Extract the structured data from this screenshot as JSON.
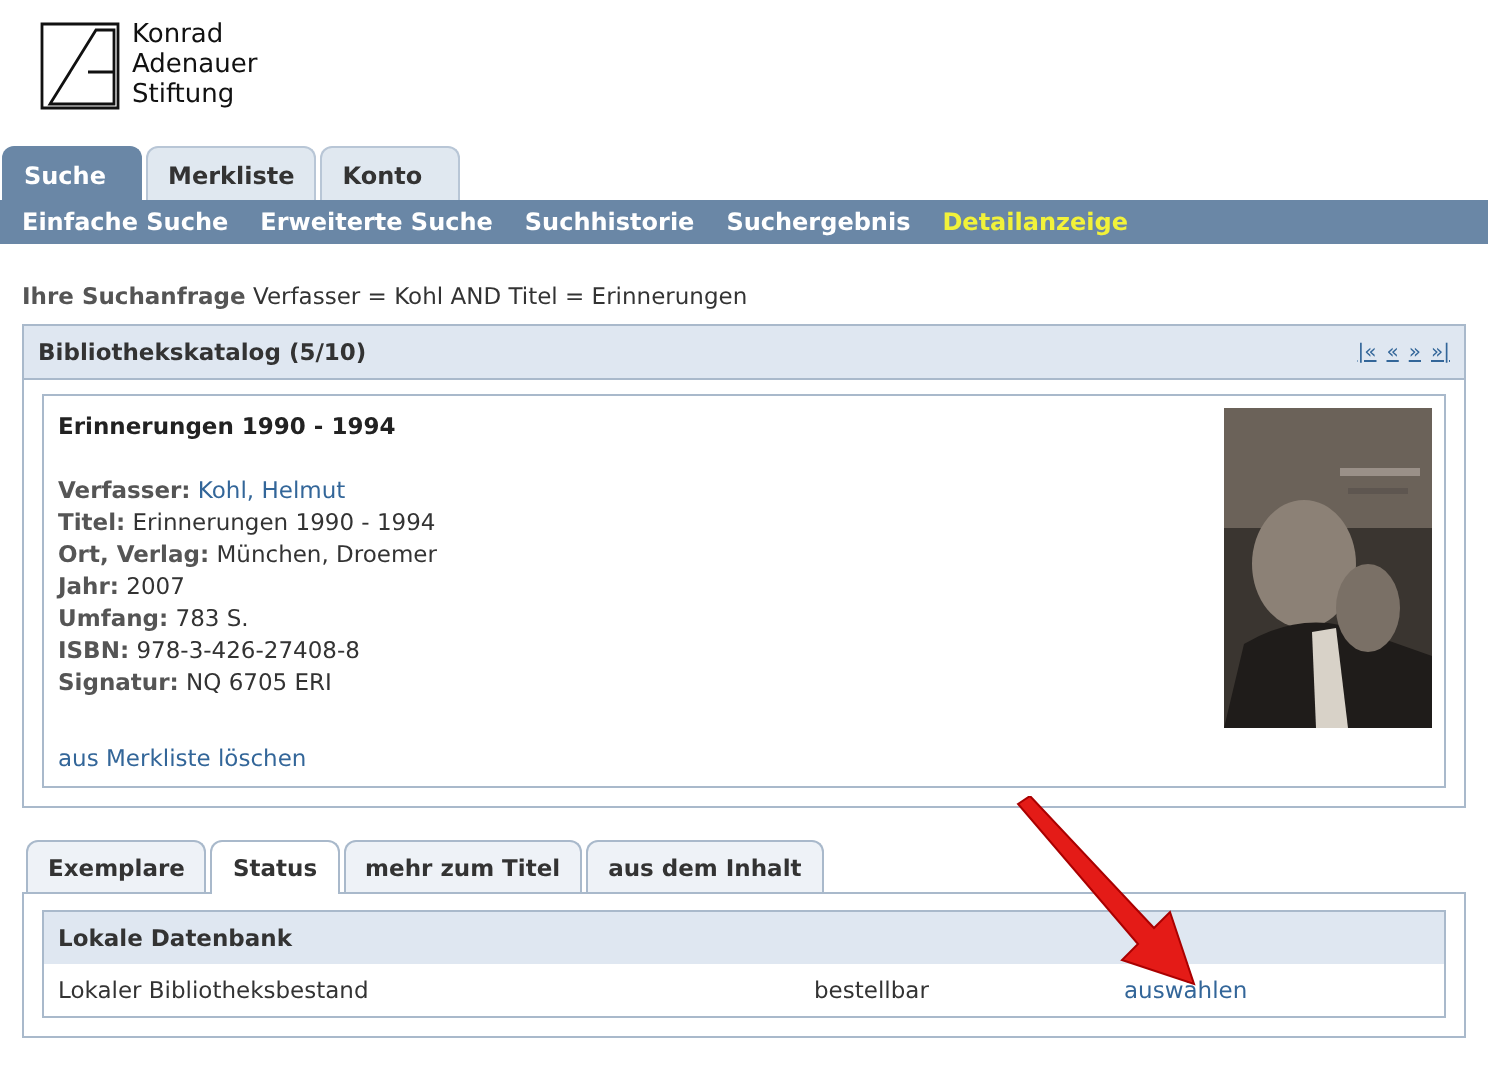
{
  "logo": {
    "lines": [
      "Konrad",
      "Adenauer",
      "Stiftung"
    ]
  },
  "main_tabs": [
    {
      "label": "Suche",
      "selected": true
    },
    {
      "label": "Merkliste",
      "selected": false
    },
    {
      "label": "Konto",
      "selected": false
    }
  ],
  "sub_nav": [
    {
      "label": "Einfache Suche",
      "selected": false
    },
    {
      "label": "Erweiterte Suche",
      "selected": false
    },
    {
      "label": "Suchhistorie",
      "selected": false
    },
    {
      "label": "Suchergebnis",
      "selected": false
    },
    {
      "label": "Detailanzeige",
      "selected": true
    }
  ],
  "query": {
    "label": "Ihre Suchanfrage",
    "value": "Verfasser = Kohl AND Titel = Erinnerungen"
  },
  "catalog": {
    "title": "Bibliothekskatalog (5/10)",
    "pager": [
      "|«",
      "«",
      "»",
      "»|"
    ],
    "record": {
      "heading": "Erinnerungen 1990 - 1994",
      "fields": [
        {
          "label": "Verfasser:",
          "value": "Kohl, Helmut",
          "kind": "link"
        },
        {
          "label": "Titel:",
          "value": "Erinnerungen 1990 - 1994",
          "kind": "text"
        },
        {
          "label": "Ort, Verlag:",
          "value": "München, Droemer",
          "kind": "text"
        },
        {
          "label": "Jahr:",
          "value": "2007",
          "kind": "text"
        },
        {
          "label": "Umfang:",
          "value": "783 S.",
          "kind": "text"
        },
        {
          "label": "ISBN:",
          "value": "978-3-426-27408-8",
          "kind": "text"
        },
        {
          "label": "Signatur:",
          "value": "NQ 6705 ERI",
          "kind": "text"
        }
      ],
      "action": "aus Merkliste löschen"
    }
  },
  "detail_tabs": [
    {
      "label": "Exemplare",
      "selected": false
    },
    {
      "label": "Status",
      "selected": true
    },
    {
      "label": "mehr zum Titel",
      "selected": false
    },
    {
      "label": "aus dem Inhalt",
      "selected": false
    }
  ],
  "status": {
    "title": "Lokale Datenbank",
    "rows": [
      {
        "location": "Lokaler Bibliotheksbestand",
        "availability": "bestellbar",
        "action": "auswählen"
      }
    ]
  }
}
